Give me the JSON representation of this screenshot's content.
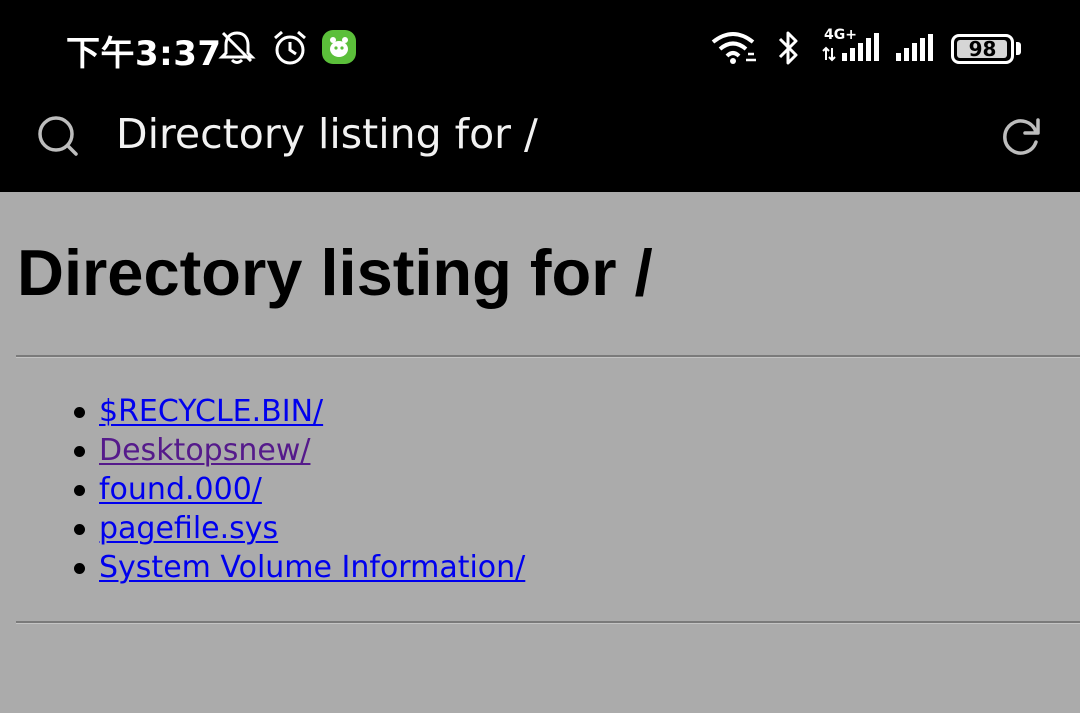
{
  "status_bar": {
    "time": "下午3:37",
    "network_type": "4G+",
    "battery_level": "98",
    "battery_fraction": 0.98
  },
  "icons": {
    "dnd": "bell-off-icon",
    "alarm": "alarm-clock-icon",
    "app": "green-app-icon",
    "wifi": "wifi-icon",
    "bluetooth": "bluetooth-icon",
    "signal": "cellular-signal-icon",
    "search": "search-icon",
    "reload": "reload-icon"
  },
  "colors": {
    "bars_bg": "#000000",
    "page_bg": "#ababab",
    "link": "#0000ee",
    "visited_link": "#551a8b",
    "app_icon": "#5bbf3a"
  },
  "address_bar": {
    "title": "Directory listing for /"
  },
  "page": {
    "heading": "Directory listing for /",
    "entries": [
      {
        "label": "$RECYCLE.BIN/",
        "visited": false
      },
      {
        "label": "Desktopsnew/",
        "visited": true
      },
      {
        "label": "found.000/",
        "visited": false
      },
      {
        "label": "pagefile.sys",
        "visited": false
      },
      {
        "label": "System Volume Information/",
        "visited": false
      }
    ]
  }
}
